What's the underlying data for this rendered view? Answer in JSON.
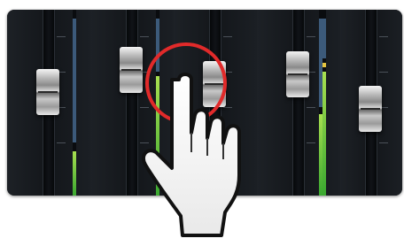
{
  "mixer": {
    "channel_count": 5,
    "faders": [
      {
        "id": "ch1",
        "level": 0.55,
        "meter": 0.28
      },
      {
        "id": "ch2",
        "level": 0.7,
        "meter": 0.22
      },
      {
        "id": "ch3",
        "level": 0.72,
        "meter": 0.72
      },
      {
        "id": "ch4",
        "level": 0.62,
        "meter": 0.6
      },
      {
        "id": "ch5",
        "level": 0.42,
        "meter": 0.45
      }
    ]
  },
  "highlight": {
    "color": "#e12a2a",
    "target": "ch3-fader"
  },
  "gesture": {
    "icon": "pointing-hand-icon",
    "action": "drag fader"
  },
  "colors": {
    "panel": "#15181c",
    "fader_cap": "#cfcfcf",
    "meter_green": "#6cc83a",
    "meter_yellow": "#e5c540"
  }
}
